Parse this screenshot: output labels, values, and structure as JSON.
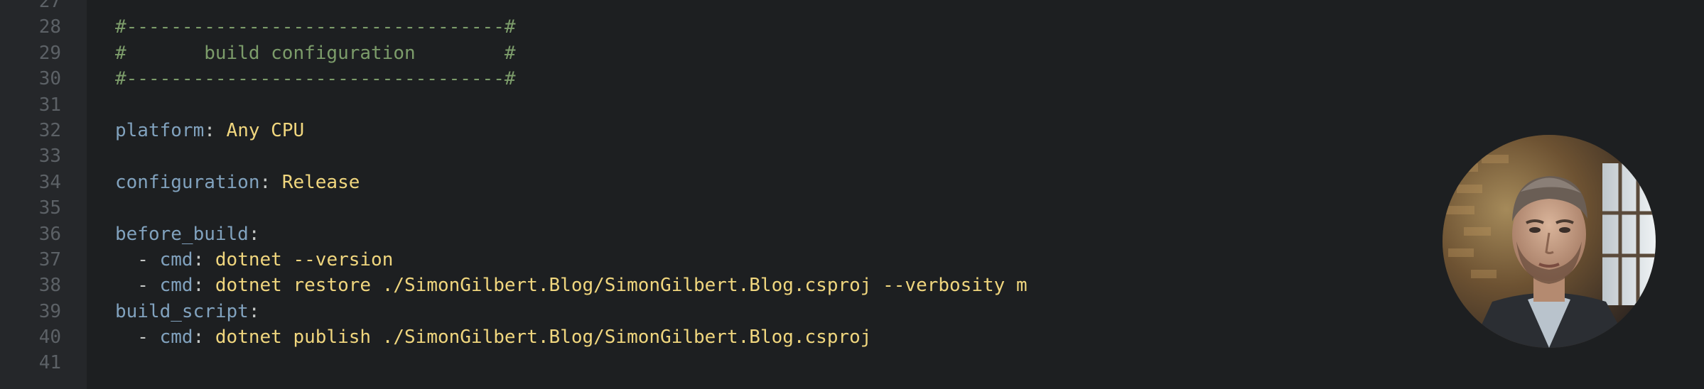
{
  "editor": {
    "line_numbers": [
      "27",
      "28",
      "29",
      "30",
      "31",
      "32",
      "33",
      "34",
      "35",
      "36",
      "37",
      "38",
      "39",
      "40",
      "41"
    ],
    "lines": [
      {
        "segments": []
      },
      {
        "segments": [
          {
            "cls": "comment",
            "text": "#----------------------------------#"
          }
        ]
      },
      {
        "segments": [
          {
            "cls": "comment",
            "text": "#       build configuration        #"
          }
        ]
      },
      {
        "segments": [
          {
            "cls": "comment",
            "text": "#----------------------------------#"
          }
        ]
      },
      {
        "segments": []
      },
      {
        "segments": [
          {
            "cls": "key",
            "text": "platform"
          },
          {
            "cls": "punct",
            "text": ": "
          },
          {
            "cls": "val",
            "text": "Any CPU"
          }
        ]
      },
      {
        "segments": []
      },
      {
        "segments": [
          {
            "cls": "key",
            "text": "configuration"
          },
          {
            "cls": "punct",
            "text": ": "
          },
          {
            "cls": "val",
            "text": "Release"
          }
        ]
      },
      {
        "segments": []
      },
      {
        "segments": [
          {
            "cls": "key",
            "text": "before_build"
          },
          {
            "cls": "punct",
            "text": ":"
          }
        ]
      },
      {
        "segments": [
          {
            "cls": "punct",
            "text": "  - "
          },
          {
            "cls": "key",
            "text": "cmd"
          },
          {
            "cls": "punct",
            "text": ": "
          },
          {
            "cls": "val",
            "text": "dotnet --version"
          }
        ]
      },
      {
        "segments": [
          {
            "cls": "punct",
            "text": "  - "
          },
          {
            "cls": "key",
            "text": "cmd"
          },
          {
            "cls": "punct",
            "text": ": "
          },
          {
            "cls": "val",
            "text": "dotnet restore ./SimonGilbert.Blog/SimonGilbert.Blog.csproj --verbosity m"
          }
        ]
      },
      {
        "segments": [
          {
            "cls": "key",
            "text": "build_script"
          },
          {
            "cls": "punct",
            "text": ":"
          }
        ]
      },
      {
        "segments": [
          {
            "cls": "punct",
            "text": "  - "
          },
          {
            "cls": "key",
            "text": "cmd"
          },
          {
            "cls": "punct",
            "text": ": "
          },
          {
            "cls": "val",
            "text": "dotnet publish ./SimonGilbert.Blog/SimonGilbert.Blog.csproj"
          }
        ]
      },
      {
        "segments": []
      }
    ]
  },
  "avatar": {
    "icon": "profile-photo"
  },
  "colors": {
    "background": "#1d1f21",
    "gutter": "#25272a",
    "line_number": "#5c6166",
    "comment": "#7c9c6a",
    "key": "#81a2be",
    "value": "#f0d67e",
    "text": "#c5c8c6"
  }
}
